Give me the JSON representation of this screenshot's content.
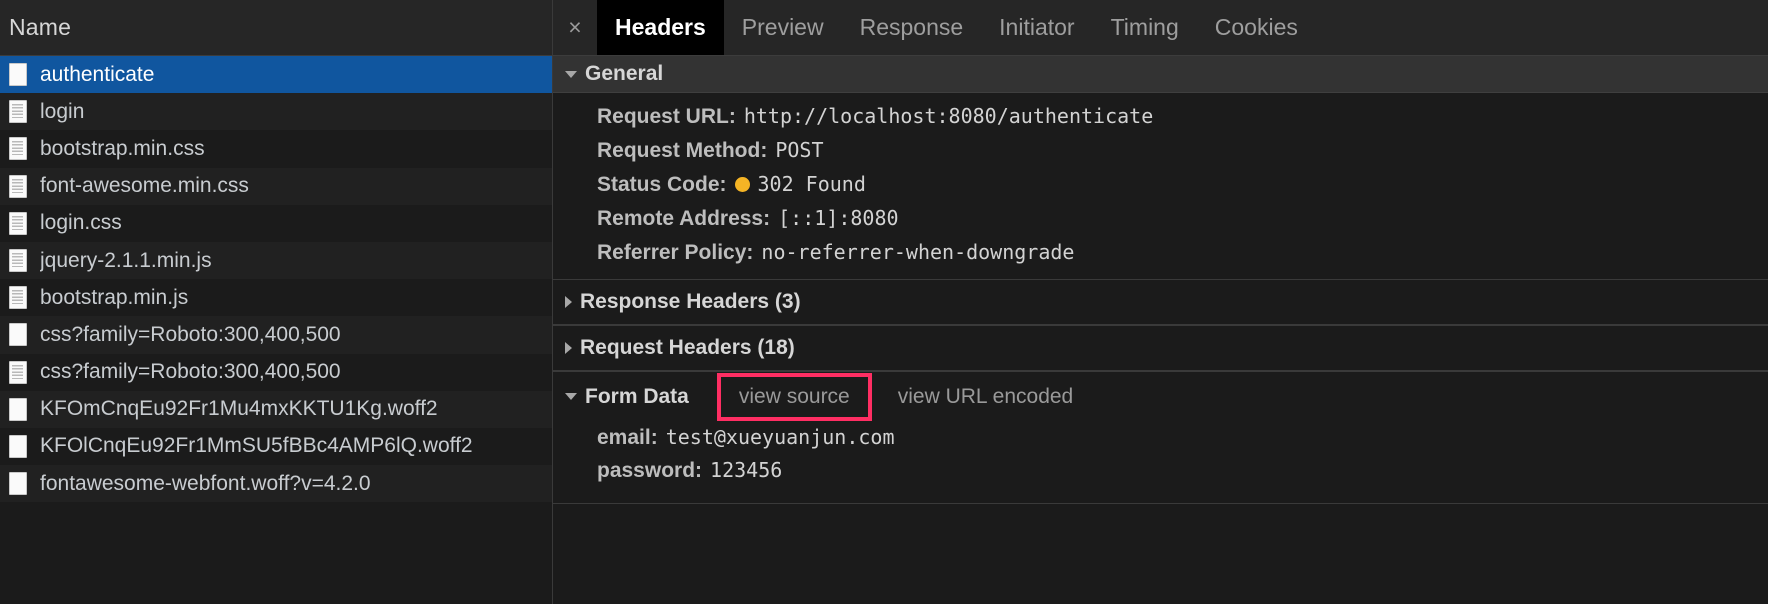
{
  "left_panel": {
    "column_header": "Name",
    "rows": [
      {
        "name": "authenticate",
        "icon": "document-blank-icon",
        "selected": true
      },
      {
        "name": "login",
        "icon": "document-lined-icon",
        "selected": false
      },
      {
        "name": "bootstrap.min.css",
        "icon": "document-lined-icon",
        "selected": false
      },
      {
        "name": "font-awesome.min.css",
        "icon": "document-lined-icon",
        "selected": false
      },
      {
        "name": "login.css",
        "icon": "document-lined-icon",
        "selected": false
      },
      {
        "name": "jquery-2.1.1.min.js",
        "icon": "document-lined-icon",
        "selected": false
      },
      {
        "name": "bootstrap.min.js",
        "icon": "document-lined-icon",
        "selected": false
      },
      {
        "name": "css?family=Roboto:300,400,500",
        "icon": "document-blank-icon",
        "selected": false
      },
      {
        "name": "css?family=Roboto:300,400,500",
        "icon": "document-lined-icon",
        "selected": false
      },
      {
        "name": "KFOmCnqEu92Fr1Mu4mxKKTU1Kg.woff2",
        "icon": "document-blank-icon",
        "selected": false
      },
      {
        "name": "KFOlCnqEu92Fr1MmSU5fBBc4AMP6lQ.woff2",
        "icon": "document-blank-icon",
        "selected": false
      },
      {
        "name": "fontawesome-webfont.woff?v=4.2.0",
        "icon": "document-blank-icon",
        "selected": false
      }
    ]
  },
  "right_panel": {
    "close_icon": "×",
    "tabs": [
      {
        "label": "Headers",
        "active": true
      },
      {
        "label": "Preview",
        "active": false
      },
      {
        "label": "Response",
        "active": false
      },
      {
        "label": "Initiator",
        "active": false
      },
      {
        "label": "Timing",
        "active": false
      },
      {
        "label": "Cookies",
        "active": false
      }
    ],
    "general": {
      "title": "General",
      "expanded": true,
      "rows": [
        {
          "key": "Request URL:",
          "value": "http://localhost:8080/authenticate"
        },
        {
          "key": "Request Method:",
          "value": "POST"
        },
        {
          "key": "Status Code:",
          "value": "302 Found",
          "status_dot": true,
          "status_color": "#f5b425"
        },
        {
          "key": "Remote Address:",
          "value": "[::1]:8080"
        },
        {
          "key": "Referrer Policy:",
          "value": "no-referrer-when-downgrade"
        }
      ]
    },
    "response_headers": {
      "title": "Response Headers (3)",
      "expanded": false
    },
    "request_headers": {
      "title": "Request Headers (18)",
      "expanded": false
    },
    "form_data": {
      "title": "Form Data",
      "expanded": true,
      "view_source_label": "view source",
      "view_source_highlighted": true,
      "highlight_color": "#ff2e63",
      "view_url_encoded_label": "view URL encoded",
      "rows": [
        {
          "key": "email:",
          "value": "test@xueyuanjun.com"
        },
        {
          "key": "password:",
          "value": "123456"
        }
      ]
    }
  }
}
